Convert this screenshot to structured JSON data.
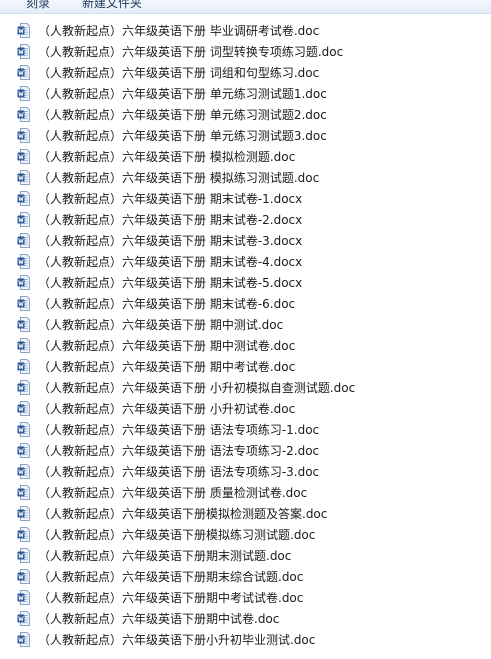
{
  "toolbar": {
    "share_label": "刻录",
    "new_folder_label": "新建文件夹"
  },
  "files": [
    {
      "name": "（人教新起点）六年级英语下册 毕业调研考试卷.doc",
      "icon": "word-doc-icon"
    },
    {
      "name": "（人教新起点）六年级英语下册 词型转换专项练习题.doc",
      "icon": "word-doc-icon"
    },
    {
      "name": "（人教新起点）六年级英语下册 词组和句型练习.doc",
      "icon": "word-doc-icon"
    },
    {
      "name": "（人教新起点）六年级英语下册 单元练习测试题1.doc",
      "icon": "word-doc-icon"
    },
    {
      "name": "（人教新起点）六年级英语下册 单元练习测试题2.doc",
      "icon": "word-doc-icon"
    },
    {
      "name": "（人教新起点）六年级英语下册 单元练习测试题3.doc",
      "icon": "word-doc-icon"
    },
    {
      "name": "（人教新起点）六年级英语下册 模拟检测题.doc",
      "icon": "word-doc-icon"
    },
    {
      "name": "（人教新起点）六年级英语下册 模拟练习测试题.doc",
      "icon": "word-doc-icon"
    },
    {
      "name": "（人教新起点）六年级英语下册 期末试卷-1.docx",
      "icon": "word-docx-icon"
    },
    {
      "name": "（人教新起点）六年级英语下册 期末试卷-2.docx",
      "icon": "word-docx-icon"
    },
    {
      "name": "（人教新起点）六年级英语下册 期末试卷-3.docx",
      "icon": "word-docx-icon"
    },
    {
      "name": "（人教新起点）六年级英语下册 期末试卷-4.docx",
      "icon": "word-docx-icon"
    },
    {
      "name": "（人教新起点）六年级英语下册 期末试卷-5.docx",
      "icon": "word-docx-icon"
    },
    {
      "name": "（人教新起点）六年级英语下册 期末试卷-6.doc",
      "icon": "word-doc-icon"
    },
    {
      "name": "（人教新起点）六年级英语下册 期中测试.doc",
      "icon": "word-doc-icon"
    },
    {
      "name": "（人教新起点）六年级英语下册 期中测试卷.doc",
      "icon": "word-doc-icon"
    },
    {
      "name": "（人教新起点）六年级英语下册 期中考试卷.doc",
      "icon": "word-doc-icon"
    },
    {
      "name": "（人教新起点）六年级英语下册 小升初模拟自查测试题.doc",
      "icon": "word-doc-icon"
    },
    {
      "name": "（人教新起点）六年级英语下册 小升初试卷.doc",
      "icon": "word-doc-icon"
    },
    {
      "name": "（人教新起点）六年级英语下册 语法专项练习-1.doc",
      "icon": "word-doc-icon"
    },
    {
      "name": "（人教新起点）六年级英语下册 语法专项练习-2.doc",
      "icon": "word-doc-icon"
    },
    {
      "name": "（人教新起点）六年级英语下册 语法专项练习-3.doc",
      "icon": "word-doc-icon"
    },
    {
      "name": "（人教新起点）六年级英语下册 质量检测试卷.doc",
      "icon": "word-doc-icon"
    },
    {
      "name": "（人教新起点）六年级英语下册模拟检测题及答案.doc",
      "icon": "word-doc-icon"
    },
    {
      "name": "（人教新起点）六年级英语下册模拟练习测试题.doc",
      "icon": "word-doc-icon"
    },
    {
      "name": "（人教新起点）六年级英语下册期末测试题.doc",
      "icon": "word-doc-icon"
    },
    {
      "name": "（人教新起点）六年级英语下册期末综合试题.doc",
      "icon": "word-doc-icon"
    },
    {
      "name": "（人教新起点）六年级英语下册期中考试试卷.doc",
      "icon": "word-doc-icon"
    },
    {
      "name": "（人教新起点）六年级英语下册期中试卷.doc",
      "icon": "word-doc-icon"
    },
    {
      "name": "（人教新起点）六年级英语下册小升初毕业测试.doc",
      "icon": "word-doc-icon"
    }
  ],
  "colors": {
    "toolbar_text": "#1e395b",
    "icon_blue": "#2b5797",
    "icon_paper": "#f2f5fa",
    "text": "#1a1a1a"
  }
}
